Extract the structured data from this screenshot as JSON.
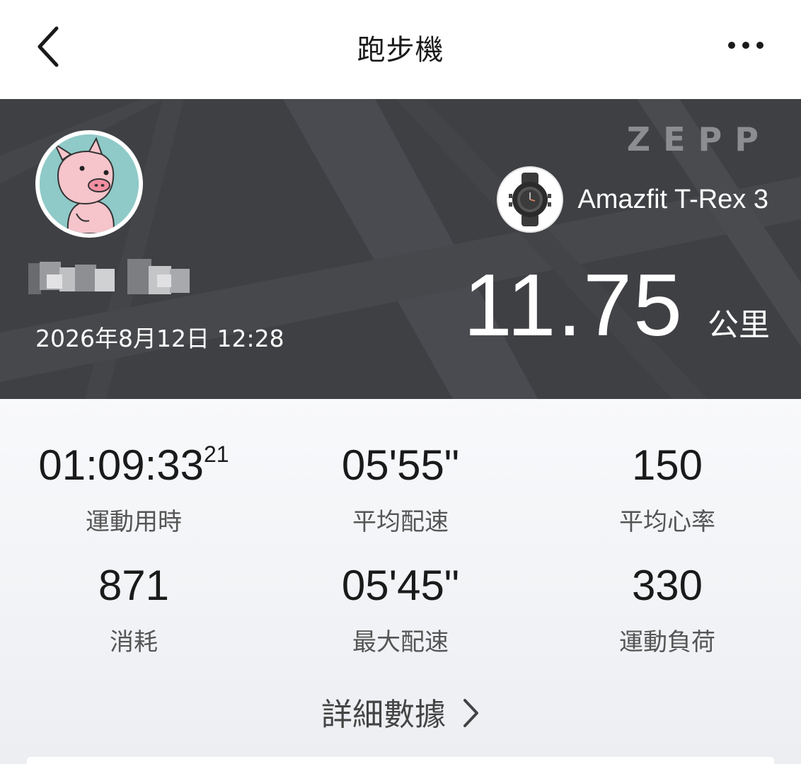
{
  "header": {
    "title": "跑步機",
    "back_icon": "chevron-left-icon",
    "more_icon": "more-horizontal-icon"
  },
  "hero": {
    "brand": "ZEPP",
    "device_name": "Amazfit T-Rex 3",
    "date": "2026年8月12日 12:28",
    "distance": "11.75",
    "distance_unit": "公里",
    "background_color": "#3f4044"
  },
  "stats": [
    {
      "value": "01:09:33",
      "sup": "21",
      "label": "運動用時"
    },
    {
      "value": "05'55\"",
      "sup": "",
      "label": "平均配速"
    },
    {
      "value": "150",
      "sup": "",
      "label": "平均心率"
    },
    {
      "value": "871",
      "sup": "",
      "label": "消耗"
    },
    {
      "value": "05'45\"",
      "sup": "",
      "label": "最大配速"
    },
    {
      "value": "330",
      "sup": "",
      "label": "運動負荷"
    }
  ],
  "details_link": "詳細數據"
}
